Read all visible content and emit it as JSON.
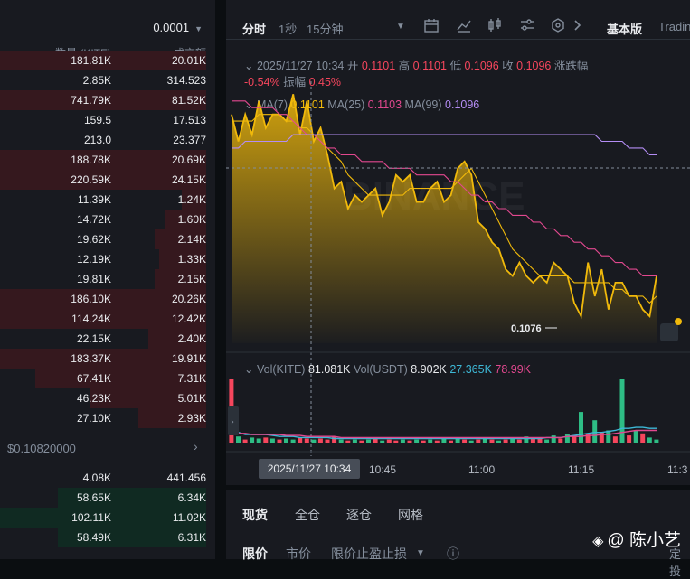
{
  "orderbook": {
    "precision": "0.0001",
    "col_qty": "数量 (KITE)",
    "col_total": "成交额",
    "asks": [
      {
        "qty": "181.81K",
        "total": "20.01K",
        "depth": 1.0
      },
      {
        "qty": "2.85K",
        "total": "314.523",
        "depth": 0.0
      },
      {
        "qty": "741.79K",
        "total": "81.52K",
        "depth": 1.0
      },
      {
        "qty": "159.5",
        "total": "17.513",
        "depth": 0.0
      },
      {
        "qty": "213.0",
        "total": "23.377",
        "depth": 0.0
      },
      {
        "qty": "188.78K",
        "total": "20.69K",
        "depth": 1.0
      },
      {
        "qty": "220.59K",
        "total": "24.15K",
        "depth": 1.0
      },
      {
        "qty": "11.39K",
        "total": "1.24K",
        "depth": 0.12
      },
      {
        "qty": "14.72K",
        "total": "1.60K",
        "depth": 0.2
      },
      {
        "qty": "19.62K",
        "total": "2.14K",
        "depth": 0.25
      },
      {
        "qty": "12.19K",
        "total": "1.33K",
        "depth": 0.23
      },
      {
        "qty": "19.81K",
        "total": "2.15K",
        "depth": 0.25
      },
      {
        "qty": "186.10K",
        "total": "20.26K",
        "depth": 1.0
      },
      {
        "qty": "114.24K",
        "total": "12.42K",
        "depth": 1.0
      },
      {
        "qty": "22.15K",
        "total": "2.40K",
        "depth": 0.28
      },
      {
        "qty": "183.37K",
        "total": "19.91K",
        "depth": 1.0
      },
      {
        "qty": "67.41K",
        "total": "7.31K",
        "depth": 0.83
      },
      {
        "qty": "46.23K",
        "total": "5.01K",
        "depth": 0.56
      },
      {
        "qty": "27.10K",
        "total": "2.93K",
        "depth": 0.33
      }
    ],
    "mark_price": "$0.10820000",
    "bids": [
      {
        "qty": "4.08K",
        "total": "441.456",
        "depth": 0.0
      },
      {
        "qty": "58.65K",
        "total": "6.34K",
        "depth": 0.72
      },
      {
        "qty": "102.11K",
        "total": "11.02K",
        "depth": 1.0
      },
      {
        "qty": "58.49K",
        "total": "6.31K",
        "depth": 0.72
      }
    ]
  },
  "toolbar": {
    "tab_timeshare": "分时",
    "tab_1s": "1秒",
    "tab_15m": "15分钟",
    "basic_version": "基本版",
    "tradingview": "Trading"
  },
  "ohlc": {
    "datetime": "2025/11/27 10:34",
    "open_label": "开",
    "open": "0.1101",
    "high_label": "高",
    "high": "0.1101",
    "low_label": "低",
    "low": "0.1096",
    "close_label": "收",
    "close": "0.1096",
    "change_label": "涨跌幅",
    "change_value": "-0.54%",
    "amplitude_label": "振幅",
    "amplitude_value": "0.45%"
  },
  "ma": {
    "ma7_label": "MA(7)",
    "ma7_value": "0.1101",
    "ma25_label": "MA(25)",
    "ma25_value": "0.1103",
    "ma99_label": "MA(99)",
    "ma99_value": "0.1096"
  },
  "volume": {
    "vol_kite_label": "Vol(KITE)",
    "vol_kite_value": "81.081K",
    "vol_usdt_label": "Vol(USDT)",
    "vol_usdt_value": "8.902K",
    "value_a": "27.365K",
    "value_b": "78.99K"
  },
  "chart": {
    "low_marker": "0.1076",
    "watermark_text": "BINANCE",
    "crosshair_date": "2025/11/27 10:34",
    "x_ticks": [
      "10:45",
      "11:00",
      "11:15",
      "11:3"
    ]
  },
  "colors": {
    "price_line": "#f0b90b",
    "ma7": "#f0b90b",
    "ma25": "#e2488f",
    "ma99": "#b48df5",
    "up": "#2ebd85",
    "down": "#f6465d",
    "background": "#181a20"
  },
  "chart_data": {
    "type": "line",
    "title": "",
    "xlabel": "",
    "ylabel": "",
    "x_ticks": [
      "10:45",
      "11:00",
      "11:15",
      "11:3"
    ],
    "ylim": [
      0.1072,
      0.1112
    ],
    "series": [
      {
        "name": "",
        "values": [
          0.1106,
          0.1102,
          0.1106,
          0.1103,
          0.1108,
          0.1104,
          0.1106,
          0.1106,
          0.1105,
          0.1109,
          0.1103,
          0.1108,
          0.1102,
          0.1104,
          0.11,
          0.1095,
          0.1096,
          0.1092,
          0.1094,
          0.1093,
          0.1094,
          0.1095,
          0.1091,
          0.1093,
          0.1097,
          0.1096,
          0.1097,
          0.1093,
          0.1093,
          0.1095,
          0.1096,
          0.1093,
          0.1094,
          0.1098,
          0.1099,
          0.1097,
          0.109,
          0.1089,
          0.1087,
          0.1086,
          0.1083,
          0.1082,
          0.1084,
          0.1082,
          0.1081,
          0.1082,
          0.1081,
          0.1084,
          0.1083,
          0.1082,
          0.1078,
          0.1076,
          0.1084,
          0.1079,
          0.1083,
          0.1077,
          0.1081,
          0.1081,
          0.1079,
          0.1079,
          0.1077,
          0.1076,
          0.1082
        ]
      },
      {
        "name": "MA(7)",
        "values": [
          0.1105,
          0.1105,
          0.1105,
          0.1105,
          0.1106,
          0.1106,
          0.1106,
          0.1106,
          0.1105,
          0.1105,
          0.1104,
          0.1104,
          0.1103,
          0.1102,
          0.1101,
          0.11,
          0.1099,
          0.1097,
          0.1096,
          0.1095,
          0.1094,
          0.1094,
          0.1094,
          0.1094,
          0.1094,
          0.1094,
          0.1095,
          0.1095,
          0.1095,
          0.1095,
          0.1095,
          0.1095,
          0.1095,
          0.1096,
          0.1097,
          0.1098,
          0.1096,
          0.1094,
          0.1092,
          0.109,
          0.1088,
          0.1086,
          0.1085,
          0.1084,
          0.1083,
          0.1082,
          0.1082,
          0.1082,
          0.1082,
          0.1082,
          0.1081,
          0.1081,
          0.1081,
          0.1081,
          0.1081,
          0.1081,
          0.108,
          0.108,
          0.1079,
          0.1079,
          0.1079,
          0.1078,
          0.1079
        ]
      },
      {
        "name": "MA(25)",
        "values": [
          0.1108,
          0.1108,
          0.1108,
          0.1107,
          0.1107,
          0.1107,
          0.1107,
          0.1106,
          0.1106,
          0.1105,
          0.1104,
          0.1103,
          0.1103,
          0.1102,
          0.1101,
          0.1101,
          0.11,
          0.11,
          0.11,
          0.1099,
          0.1099,
          0.1099,
          0.1099,
          0.1098,
          0.1098,
          0.1098,
          0.1098,
          0.1097,
          0.1097,
          0.1097,
          0.1097,
          0.1097,
          0.1096,
          0.1096,
          0.1095,
          0.1094,
          0.1094,
          0.1093,
          0.1093,
          0.1092,
          0.1092,
          0.1091,
          0.1091,
          0.1091,
          0.109,
          0.109,
          0.1089,
          0.1089,
          0.1088,
          0.1088,
          0.1087,
          0.1087,
          0.1086,
          0.1086,
          0.1085,
          0.1085,
          0.1084,
          0.1084,
          0.1083,
          0.1083,
          0.1082,
          0.1082,
          0.1082
        ]
      },
      {
        "name": "MA(99)",
        "values": [
          0.1101,
          0.1101,
          0.1102,
          0.1102,
          0.1102,
          0.1102,
          0.1102,
          0.1102,
          0.1102,
          0.1103,
          0.1103,
          0.1103,
          0.1103,
          0.1103,
          0.1103,
          0.1103,
          0.1103,
          0.1103,
          0.1103,
          0.1103,
          0.1103,
          0.1103,
          0.1103,
          0.1103,
          0.1103,
          0.1103,
          0.1103,
          0.1103,
          0.1103,
          0.1103,
          0.1103,
          0.1103,
          0.1103,
          0.1103,
          0.1103,
          0.1103,
          0.1103,
          0.1103,
          0.1103,
          0.1103,
          0.1103,
          0.1103,
          0.1103,
          0.1103,
          0.1103,
          0.1103,
          0.1103,
          0.1103,
          0.1103,
          0.1103,
          0.1103,
          0.1103,
          0.1103,
          0.1103,
          0.1102,
          0.1102,
          0.1102,
          0.1102,
          0.1101,
          0.1101,
          0.1101,
          0.11,
          0.11
        ]
      }
    ],
    "volume_bars": [
      {
        "v": 62,
        "up": false
      },
      {
        "v": 6,
        "up": true
      },
      {
        "v": 3,
        "up": false
      },
      {
        "v": 5,
        "up": true
      },
      {
        "v": 4,
        "up": true
      },
      {
        "v": 5,
        "up": false
      },
      {
        "v": 4,
        "up": true
      },
      {
        "v": 3,
        "up": false
      },
      {
        "v": 4,
        "up": true
      },
      {
        "v": 3,
        "up": true
      },
      {
        "v": 5,
        "up": false
      },
      {
        "v": 4,
        "up": false
      },
      {
        "v": 3,
        "up": true
      },
      {
        "v": 4,
        "up": false
      },
      {
        "v": 3,
        "up": false
      },
      {
        "v": 6,
        "up": false
      },
      {
        "v": 3,
        "up": true
      },
      {
        "v": 2,
        "up": false
      },
      {
        "v": 3,
        "up": true
      },
      {
        "v": 2,
        "up": false
      },
      {
        "v": 3,
        "up": true
      },
      {
        "v": 4,
        "up": false
      },
      {
        "v": 2,
        "up": true
      },
      {
        "v": 3,
        "up": false
      },
      {
        "v": 2,
        "up": false
      },
      {
        "v": 3,
        "up": true
      },
      {
        "v": 2,
        "up": false
      },
      {
        "v": 3,
        "up": true
      },
      {
        "v": 2,
        "up": false
      },
      {
        "v": 3,
        "up": true
      },
      {
        "v": 2,
        "up": false
      },
      {
        "v": 4,
        "up": true
      },
      {
        "v": 2,
        "up": false
      },
      {
        "v": 5,
        "up": true
      },
      {
        "v": 3,
        "up": false
      },
      {
        "v": 2,
        "up": true
      },
      {
        "v": 3,
        "up": false
      },
      {
        "v": 4,
        "up": true
      },
      {
        "v": 3,
        "up": false
      },
      {
        "v": 2,
        "up": true
      },
      {
        "v": 3,
        "up": false
      },
      {
        "v": 5,
        "up": true
      },
      {
        "v": 3,
        "up": false
      },
      {
        "v": 6,
        "up": true
      },
      {
        "v": 4,
        "up": false
      },
      {
        "v": 5,
        "up": false
      },
      {
        "v": 3,
        "up": true
      },
      {
        "v": 7,
        "up": true
      },
      {
        "v": 4,
        "up": false
      },
      {
        "v": 8,
        "up": true
      },
      {
        "v": 6,
        "up": false
      },
      {
        "v": 30,
        "up": true
      },
      {
        "v": 8,
        "up": false
      },
      {
        "v": 22,
        "up": true
      },
      {
        "v": 10,
        "up": false
      },
      {
        "v": 12,
        "up": true
      },
      {
        "v": 6,
        "up": false
      },
      {
        "v": 62,
        "up": true
      },
      {
        "v": 7,
        "up": false
      },
      {
        "v": 12,
        "up": true
      },
      {
        "v": 9,
        "up": false
      },
      {
        "v": 5,
        "up": true
      },
      {
        "v": 3,
        "up": true
      }
    ]
  },
  "trade_panel": {
    "tab_spot": "现货",
    "tab_cross": "全仓",
    "tab_isolated": "逐仓",
    "tab_grid": "网格",
    "order_limit": "限价",
    "order_market": "市价",
    "order_stop_limit": "限价止盈止损",
    "tp_cut": "定投"
  },
  "watermark": {
    "text": "@ 陈小艺"
  }
}
